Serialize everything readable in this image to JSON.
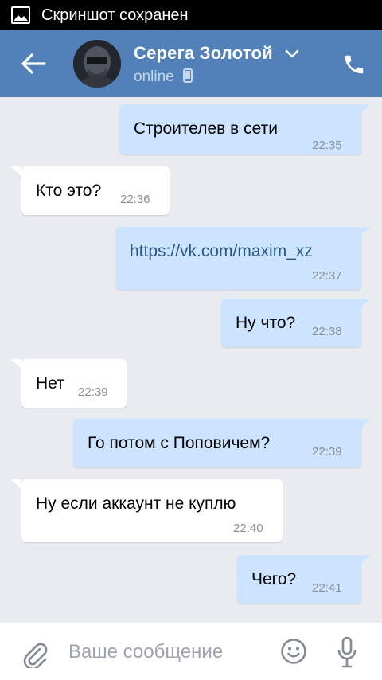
{
  "statusbar": {
    "notification": "Скриншот сохранен",
    "icon": "image-icon"
  },
  "header": {
    "back_icon": "arrow-left-icon",
    "contact_name": "Серега Золотой",
    "status": "online",
    "status_icon": "mobile-phone-icon",
    "call_icon": "phone-icon"
  },
  "messages": [
    {
      "dir": "out",
      "text": "Строителев в сети",
      "time": "22:35"
    },
    {
      "dir": "in",
      "text": "Кто это?",
      "time": "22:36"
    },
    {
      "dir": "out",
      "text": "https://vk.com/maxim_xz",
      "time": "22:37",
      "is_link": true
    },
    {
      "dir": "out",
      "text": "Ну что?",
      "time": "22:38"
    },
    {
      "dir": "in",
      "text": "Нет",
      "time": "22:39"
    },
    {
      "dir": "out",
      "text": "Го потом с Поповичем?",
      "time": "22:39"
    },
    {
      "dir": "in",
      "text": "Ну если аккаунт не куплю",
      "time": "22:40"
    },
    {
      "dir": "out",
      "text": "Чего?",
      "time": "22:41"
    }
  ],
  "composer": {
    "placeholder": "Ваше сообщение",
    "value": ""
  },
  "colors": {
    "header": "#5181b8",
    "outgoing_bubble": "#cce4ff",
    "incoming_bubble": "#ffffff",
    "background": "#e8ecf1",
    "link": "#2a5885"
  }
}
